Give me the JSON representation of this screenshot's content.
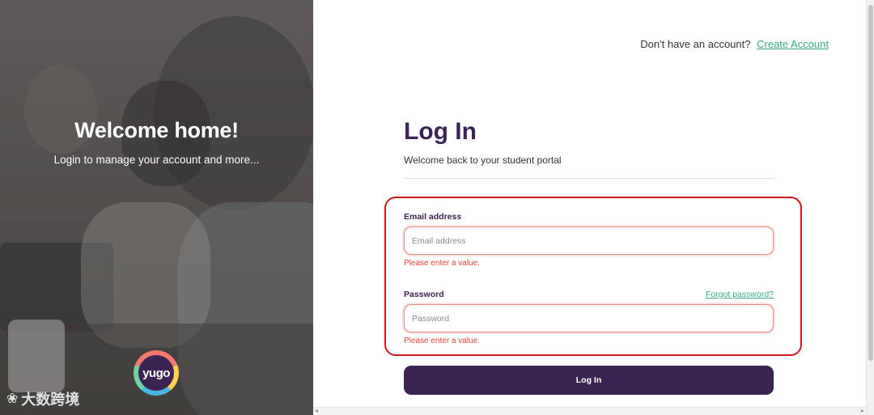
{
  "hero": {
    "title": "Welcome home!",
    "subtitle": "Login to manage your account and more...",
    "logo_text": "yugo",
    "watermark": "大数跨境"
  },
  "header": {
    "prompt": "Don't have an account?",
    "create_account_label": "Create Account"
  },
  "form": {
    "title": "Log In",
    "subtitle": "Welcome back to your student portal",
    "email_label": "Email address",
    "email_placeholder": "Email address",
    "email_value": "",
    "email_error": "Please enter a value.",
    "password_label": "Password",
    "password_placeholder": "Password",
    "password_value": "",
    "password_error": "Please enter a value.",
    "forgot_password_label": "Forgot password?",
    "login_button_label": "Log In"
  },
  "colors": {
    "brand_purple": "#3b2453",
    "link_green": "#3aa987",
    "error_red": "#e0443a",
    "highlight_red": "#d0151d"
  }
}
